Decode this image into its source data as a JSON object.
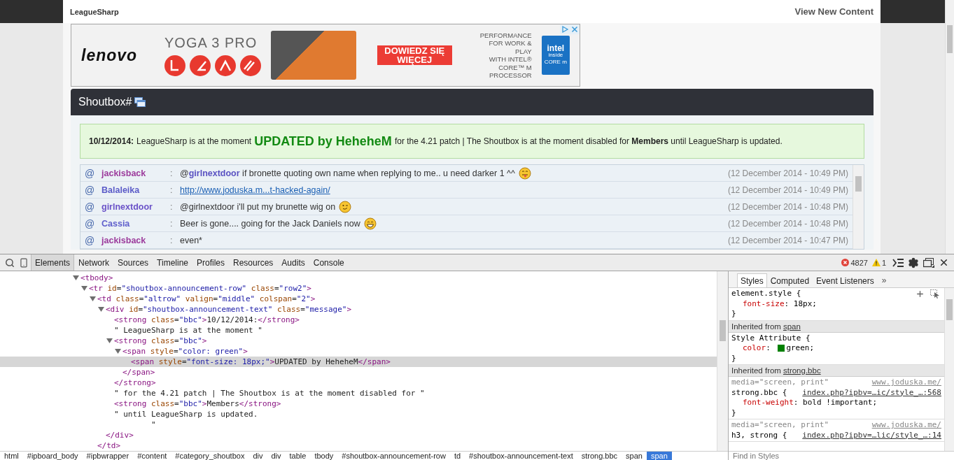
{
  "page": {
    "brand": "LeagueSharp",
    "nav_link": "View New Content"
  },
  "ad": {
    "logo": "lenovo",
    "product": "YOGA 3 PRO",
    "cta": "DOWIEDZ SIĘ WIĘCEJ",
    "tagline_lines": [
      "PERFORMANCE",
      "FOR WORK & PLAY",
      "WITH INTEL®",
      "CORE™ M",
      "PROCESSOR"
    ],
    "badge_lines": [
      "intel",
      "inside",
      "CORE m"
    ]
  },
  "shoutbox": {
    "title": "Shoutbox#",
    "announcement": {
      "date": "10/12/2014:",
      "parts": [
        {
          "kind": "plain",
          "text": "LeagueSharp is at the moment"
        },
        {
          "kind": "highlight",
          "text": "UPDATED by HeheheM"
        },
        {
          "kind": "plain",
          "text": "for the 4.21 patch | The Shoutbox is at the moment disabled for **Members** until LeagueSharp is updated."
        }
      ]
    },
    "shouts": [
      {
        "prefix": "@",
        "user": "jackisback",
        "color": "#9c3b9c",
        "sep": ":",
        "kind": "text",
        "mention": {
          "at": "@",
          "name": "girlnextdoor"
        },
        "text": "if bronette quoting own name when replying to me.. u need darker 1 ^^",
        "emoji": {
          "kind": "tongue"
        },
        "time": "(12 December 2014 - 10:49 PM)"
      },
      {
        "prefix": "@",
        "user": "Balaleika",
        "color": "#5b5bc8",
        "sep": ":",
        "kind": "link",
        "text": "http://www.joduska.m...t-hacked-again/",
        "time": "(12 December 2014 - 10:49 PM)"
      },
      {
        "prefix": "@",
        "user": "girlnextdoor",
        "color": "#6a52c8",
        "sep": ":",
        "kind": "text",
        "text": "@girlnextdoor i'll put my brunette wig on",
        "emoji": {
          "kind": "wink"
        },
        "time": "(12 December 2014 - 10:48 PM)"
      },
      {
        "prefix": "@",
        "user": "Cassia",
        "color": "#6060cc",
        "sep": ":",
        "kind": "text",
        "text": "Beer is gone.... going for the Jack Daniels now",
        "emoji": {
          "kind": "grin"
        },
        "time": "(12 December 2014 - 10:48 PM)"
      },
      {
        "prefix": "@",
        "user": "jackisback",
        "color": "#9c3b9c",
        "sep": ":",
        "kind": "text",
        "text": "even*",
        "time": "(12 December 2014 - 10:47 PM)"
      }
    ]
  },
  "devtools": {
    "tabs": [
      {
        "label": "Elements",
        "selected": true
      },
      {
        "label": "Network",
        "selected": false
      },
      {
        "label": "Sources",
        "selected": false
      },
      {
        "label": "Timeline",
        "selected": false
      },
      {
        "label": "Profiles",
        "selected": false
      },
      {
        "label": "Resources",
        "selected": false
      },
      {
        "label": "Audits",
        "selected": false
      },
      {
        "label": "Console",
        "selected": false
      }
    ],
    "errors": "4827",
    "warnings": "1",
    "dom_tree": [
      {
        "line": "<tbody>",
        "expanded": true,
        "children": [
          {
            "line": "<tr id=\"shoutbox-announcement-row\" class=\"row2\">",
            "expanded": true,
            "children": [
              {
                "line": "<td class=\"altrow\" valign=\"middle\" colspan=\"2\">",
                "expanded": true,
                "close": "</td>",
                "children": [
                  {
                    "line": "<div id=\"shoutbox-announcement-text\" class=\"message\">",
                    "expanded": true,
                    "close": "</div>",
                    "children": [
                      {
                        "line": "<strong class=\"bbc\">10/12/2014:</strong>",
                        "selected": false
                      },
                      {
                        "line": "\" LeagueSharp is at the moment \"",
                        "selected": false
                      },
                      {
                        "line": "<strong class=\"bbc\">",
                        "expanded": true,
                        "close": "</strong>",
                        "children": [
                          {
                            "line": "<span style=\"color: green\">",
                            "expanded": true,
                            "close": "</span>",
                            "children": [
                              {
                                "line": "<span style=\"font-size: 18px;\">UPDATED by HeheheM</span>",
                                "selected": true
                              }
                            ]
                          }
                        ]
                      },
                      {
                        "line": "\" for the 4.21 patch | The Shoutbox is at the moment disabled for \"",
                        "selected": false
                      },
                      {
                        "line": "<strong class=\"bbc\">Members</strong>",
                        "selected": false
                      },
                      {
                        "line": "\" until LeagueSharp is updated.\n        \"",
                        "selected": false
                      }
                    ]
                  }
                ]
              }
            ]
          }
        ]
      }
    ],
    "breadcrumb": [
      {
        "label": "html",
        "selected": false
      },
      {
        "label": "#ipboard_body",
        "selected": false
      },
      {
        "label": "#ipbwrapper",
        "selected": false
      },
      {
        "label": "#content",
        "selected": false
      },
      {
        "label": "#category_shoutbox",
        "selected": false
      },
      {
        "label": "div",
        "selected": false
      },
      {
        "label": "div",
        "selected": false
      },
      {
        "label": "table",
        "selected": false
      },
      {
        "label": "tbody",
        "selected": false
      },
      {
        "label": "#shoutbox-announcement-row",
        "selected": false
      },
      {
        "label": "td",
        "selected": false
      },
      {
        "label": "#shoutbox-announcement-text",
        "selected": false
      },
      {
        "label": "strong.bbc",
        "selected": false
      },
      {
        "label": "span",
        "selected": false
      },
      {
        "label": "span",
        "selected": true
      }
    ],
    "styles": {
      "tabs": [
        {
          "label": "Styles",
          "selected": true
        },
        {
          "label": "Computed",
          "selected": false
        },
        {
          "label": "Event Listeners",
          "selected": false
        }
      ],
      "more": "»",
      "sections": [
        {
          "kind": "rule",
          "selector": "element.style {",
          "tools": true,
          "properties": [
            {
              "name": "font-size",
              "sep": ":",
              "value": "18px;"
            }
          ],
          "close": "}"
        },
        {
          "kind": "inherited",
          "label": "Inherited from",
          "link": "span"
        },
        {
          "kind": "rule",
          "selector": "Style Attribute {",
          "properties": [
            {
              "name": "color",
              "sep": ":",
              "value": "green;",
              "color": "#008000"
            }
          ],
          "close": "}"
        },
        {
          "kind": "inherited",
          "label": "Inherited from",
          "link": "strong.bbc"
        },
        {
          "kind": "rule",
          "media": "media=\"screen, print\"",
          "origin": "www.joduska.me/",
          "selector": "strong.bbc {",
          "source": "index.php?ipbv=…ic/style_…:568",
          "properties": [
            {
              "name": "font-weight",
              "sep": ":",
              "value": "bold !important;"
            }
          ],
          "close": "}"
        },
        {
          "kind": "rule",
          "media": "media=\"screen, print\"",
          "origin": "www.joduska.me/",
          "selector": "h3, strong {",
          "source": "index.php?ipbv=…lic/style_…:14"
        }
      ],
      "filter_placeholder": "Find in Styles"
    }
  }
}
